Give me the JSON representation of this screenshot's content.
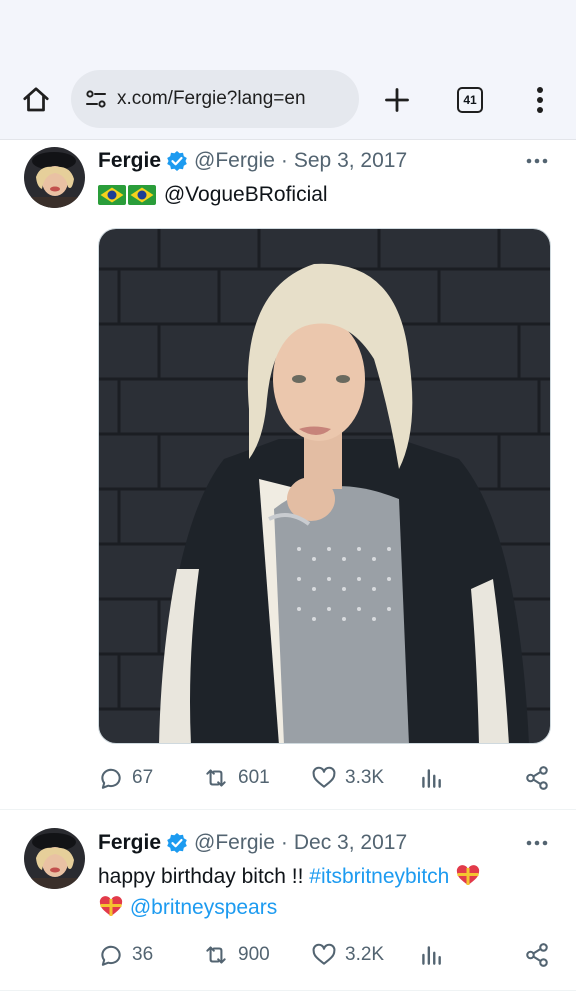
{
  "browser": {
    "url": "x.com/Fergie?lang=en",
    "tab_count": "41",
    "icons": [
      "home-icon",
      "site-settings-icon",
      "plus-icon",
      "tabs-icon",
      "kebab-menu-icon"
    ]
  },
  "tweets": [
    {
      "author": "Fergie",
      "handle": "@Fergie",
      "separator": "·",
      "date": "Sep 3, 2017",
      "text_mention": "@VogueBRoficial",
      "flags": [
        "brazil-flag-emoji",
        "brazil-flag-emoji"
      ],
      "media": "photo",
      "stats": {
        "replies": "67",
        "reposts": "601",
        "likes": "3.3K"
      }
    },
    {
      "author": "Fergie",
      "handle": "@Fergie",
      "separator": "·",
      "date": "Dec 3, 2017",
      "text_plain": "happy birthday bitch !! ",
      "hashtag": "#itsbritneybitch",
      "mention": "@britneyspears",
      "stats": {
        "replies": "36",
        "reposts": "900",
        "likes": "3.2K"
      }
    }
  ],
  "colors": {
    "accent_blue": "#1d9bf0",
    "secondary_text": "#536471",
    "browser_bar": "#f3f5fb",
    "url_pill": "#e5e8ee"
  }
}
